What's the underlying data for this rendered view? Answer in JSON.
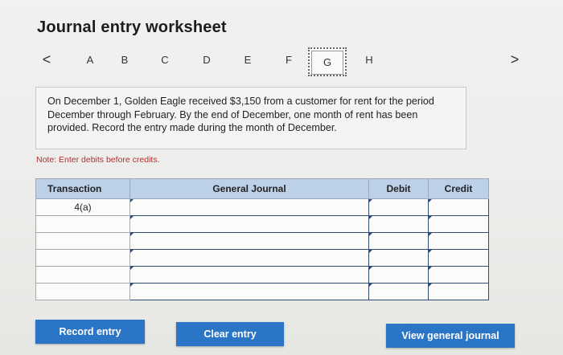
{
  "title": "Journal entry worksheet",
  "nav": {
    "prev": "<",
    "next": ">",
    "tabs": [
      "A",
      "B",
      "C",
      "D",
      "E",
      "F",
      "G",
      "H"
    ],
    "active_tab": "G"
  },
  "problem_text": "On December 1, Golden Eagle received $3,150 from a customer for rent for the period December through February. By the end of December, one month of rent has been provided. Record the entry made during the month of December.",
  "note": "Note: Enter debits before credits.",
  "table": {
    "headers": {
      "transaction": "Transaction",
      "general_journal": "General Journal",
      "debit": "Debit",
      "credit": "Credit"
    },
    "rows": [
      {
        "transaction": "4(a)"
      },
      {
        "transaction": ""
      },
      {
        "transaction": ""
      },
      {
        "transaction": ""
      },
      {
        "transaction": ""
      },
      {
        "transaction": ""
      }
    ]
  },
  "buttons": {
    "record": "Record entry",
    "clear": "Clear entry",
    "view": "View general journal"
  },
  "colors": {
    "header_bg": "#bcd0e8",
    "button_bg": "#2b75c6",
    "note": "#b13030"
  }
}
